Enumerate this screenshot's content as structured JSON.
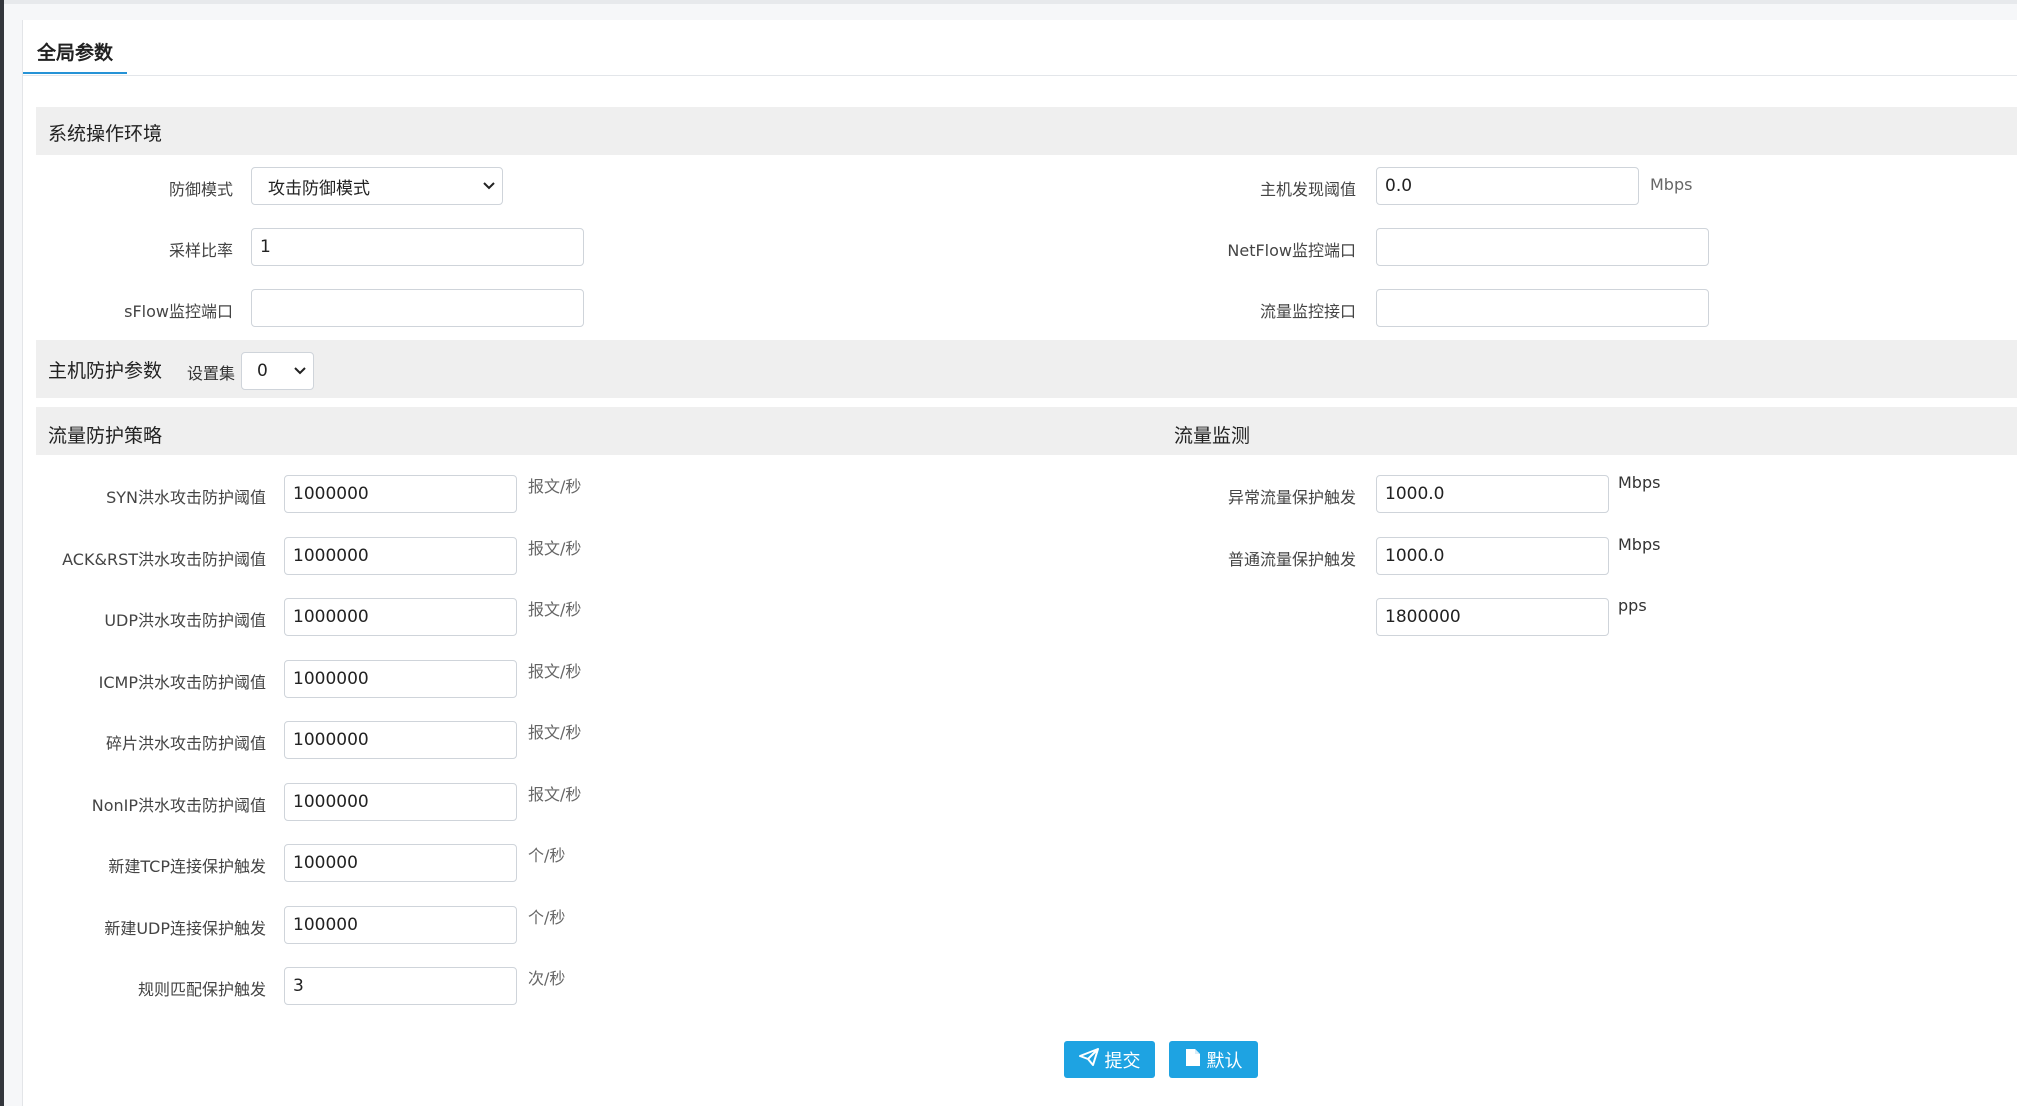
{
  "tab": {
    "title": "全局参数"
  },
  "system_env": {
    "title": "系统操作环境",
    "defense_mode": {
      "label": "防御模式",
      "value": "攻击防御模式"
    },
    "sample_rate": {
      "label": "采样比率",
      "value": "1"
    },
    "sflow_port": {
      "label": "sFlow监控端口",
      "value": ""
    },
    "host_discovery": {
      "label": "主机发现阈值",
      "value": "0.0",
      "unit": "Mbps"
    },
    "netflow_port": {
      "label": "NetFlow监控端口",
      "value": ""
    },
    "flow_interface": {
      "label": "流量监控接口",
      "value": ""
    }
  },
  "host_protect": {
    "title": "主机防护参数",
    "set_label": "设置集",
    "set_value": "0"
  },
  "flow_strategy": {
    "title": "流量防护策略",
    "rows": [
      {
        "label": "SYN洪水攻击防护阈值",
        "value": "1000000",
        "unit": "报文/秒"
      },
      {
        "label": "ACK&RST洪水攻击防护阈值",
        "value": "1000000",
        "unit": "报文/秒"
      },
      {
        "label": "UDP洪水攻击防护阈值",
        "value": "1000000",
        "unit": "报文/秒"
      },
      {
        "label": "ICMP洪水攻击防护阈值",
        "value": "1000000",
        "unit": "报文/秒"
      },
      {
        "label": "碎片洪水攻击防护阈值",
        "value": "1000000",
        "unit": "报文/秒"
      },
      {
        "label": "NonIP洪水攻击防护阈值",
        "value": "1000000",
        "unit": "报文/秒"
      },
      {
        "label": "新建TCP连接保护触发",
        "value": "100000",
        "unit": "个/秒"
      },
      {
        "label": "新建UDP连接保护触发",
        "value": "100000",
        "unit": "个/秒"
      },
      {
        "label": "规则匹配保护触发",
        "value": "3",
        "unit": "次/秒"
      }
    ]
  },
  "flow_monitor": {
    "title": "流量监测",
    "rows": [
      {
        "label": "异常流量保护触发",
        "value": "1000.0",
        "unit": "Mbps"
      },
      {
        "label": "普通流量保护触发",
        "value": "1000.0",
        "unit": "Mbps"
      },
      {
        "label": "",
        "value": "1800000",
        "unit": "pps"
      }
    ]
  },
  "buttons": {
    "submit": "提交",
    "default": "默认"
  },
  "colors": {
    "accent": "#1ea3e2",
    "tab_underline": "#2693d6",
    "section_bg": "#efefef"
  }
}
